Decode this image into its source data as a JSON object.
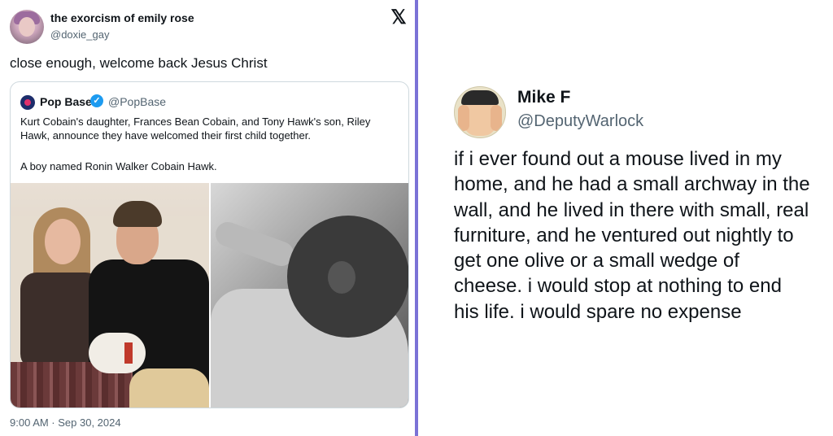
{
  "left_tweet": {
    "author_name": "the exorcism of emily rose",
    "author_handle": "@doxie_gay",
    "text": "close enough, welcome back Jesus Christ",
    "timestamp": "9:00 AM · Sep 30, 2024",
    "platform_icon": "x-logo-icon",
    "quoted": {
      "author_name": "Pop Base",
      "author_handle": "@PopBase",
      "verified": true,
      "text_line1": "Kurt Cobain's daughter, Frances Bean Cobain, and Tony Hawk's son, Riley Hawk, announce they have welcomed their first child together.",
      "text_line2": "A boy named Ronin Walker Cobain Hawk."
    }
  },
  "right_tweet": {
    "author_name": "Mike F",
    "author_handle": "@DeputyWarlock",
    "text": "if i ever found out a mouse lived in my home, and he had a small archway in the wall, and he lived in there with small, real furniture, and he ventured out nightly to get one olive or a small wedge of cheese. i would stop at nothing to end his life. i would spare no expense"
  },
  "colors": {
    "divider": "#7b72d6",
    "verified_blue": "#1d9bf0",
    "secondary_text": "#536471"
  }
}
